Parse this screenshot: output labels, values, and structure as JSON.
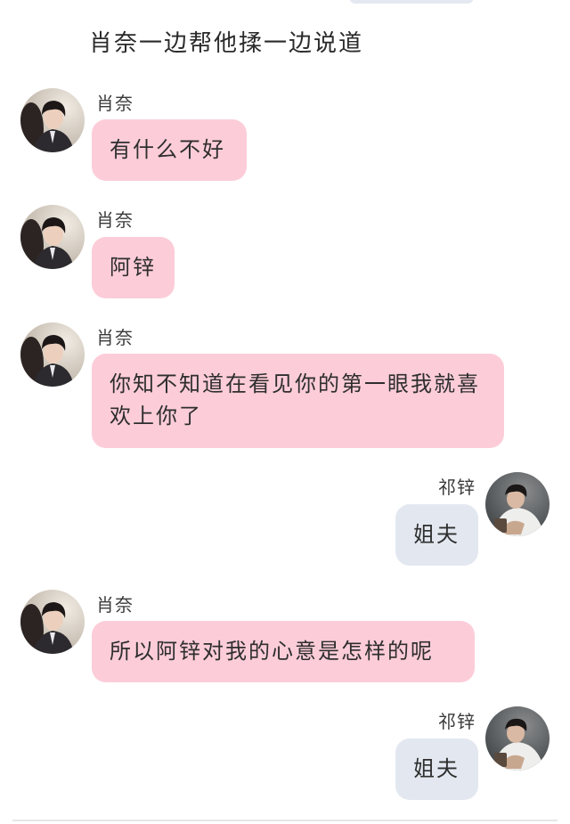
{
  "narration": "肖奈一边帮他揉一边说道",
  "messages": [
    {
      "sender": "肖奈",
      "text": "有什么不好",
      "side": "left",
      "avatar": "xiaonai-avatar"
    },
    {
      "sender": "肖奈",
      "text": "阿锌",
      "side": "left",
      "avatar": "xiaonai-avatar"
    },
    {
      "sender": "肖奈",
      "text": "你知不知道在看见你的第一眼我就喜欢上你了",
      "side": "left",
      "avatar": "xiaonai-avatar"
    },
    {
      "sender": "祁锌",
      "text": "姐夫",
      "side": "right",
      "avatar": "qixin-avatar"
    },
    {
      "sender": "肖奈",
      "text": "所以阿锌对我的心意是怎样的呢",
      "side": "left",
      "avatar": "xiaonai-avatar"
    },
    {
      "sender": "祁锌",
      "text": "姐夫",
      "side": "right",
      "avatar": "qixin-avatar"
    }
  ],
  "colors": {
    "left_bubble": "#fccdd9",
    "right_bubble": "#e3e8f0",
    "background": "#ffffff"
  }
}
